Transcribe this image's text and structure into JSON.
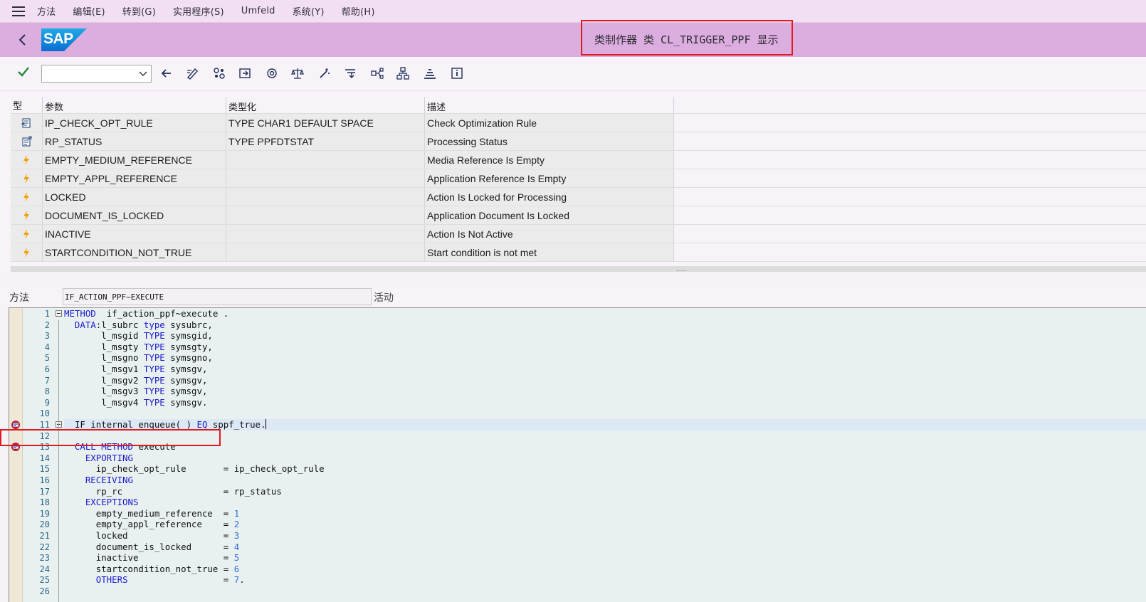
{
  "menu": {
    "items": [
      "方法",
      "编辑(E)",
      "转到(G)",
      "实用程序(S)",
      "Umfeld",
      "系统(Y)",
      "帮助(H)"
    ]
  },
  "header": {
    "logo_text": "SAP",
    "title": "类制作器 类 CL_TRIGGER_PPF 显示"
  },
  "toolbar": {
    "combo_value": "",
    "icons": [
      "check-icon",
      "back-arrow-icon",
      "display-change-icon",
      "activate-icon",
      "where-used-icon",
      "object-list-icon",
      "balance-icon",
      "pattern-icon",
      "pretty-print-icon",
      "navigate-icon",
      "hierarchy-icon",
      "stack-icon",
      "info-icon"
    ]
  },
  "params": {
    "headers": [
      "型",
      "参数",
      "类型化",
      "描述"
    ],
    "rows": [
      {
        "icon": "import-param-icon",
        "name": "IP_CHECK_OPT_RULE",
        "typing": "TYPE CHAR1  DEFAULT SPACE",
        "desc": "Check Optimization Rule"
      },
      {
        "icon": "return-param-icon",
        "name": "RP_STATUS",
        "typing": "TYPE PPFDTSTAT",
        "desc": "Processing Status"
      },
      {
        "icon": "exception-icon",
        "name": "EMPTY_MEDIUM_REFERENCE",
        "typing": "",
        "desc": "Media Reference Is Empty"
      },
      {
        "icon": "exception-icon",
        "name": "EMPTY_APPL_REFERENCE",
        "typing": "",
        "desc": "Application Reference Is Empty"
      },
      {
        "icon": "exception-icon",
        "name": "LOCKED",
        "typing": "",
        "desc": "Action Is Locked for Processing"
      },
      {
        "icon": "exception-icon",
        "name": "DOCUMENT_IS_LOCKED",
        "typing": "",
        "desc": "Application Document Is Locked"
      },
      {
        "icon": "exception-icon",
        "name": "INACTIVE",
        "typing": "",
        "desc": "Action Is Not Active"
      },
      {
        "icon": "exception-icon",
        "name": "STARTCONDITION_NOT_TRUE",
        "typing": "",
        "desc": "Start condition is not met"
      }
    ]
  },
  "method": {
    "label": "方法",
    "name": "IF_ACTION_PPF~EXECUTE",
    "status": "活动"
  },
  "code": {
    "lines": [
      {
        "n": "1",
        "parts": [
          [
            "kw",
            "METHOD"
          ],
          [
            "",
            "  if_action_ppf~execute ."
          ]
        ]
      },
      {
        "n": "2",
        "parts": [
          [
            "",
            "  "
          ],
          [
            "kw",
            "DATA"
          ],
          [
            "",
            ":l_subrc "
          ],
          [
            "kw",
            "type"
          ],
          [
            "",
            " sysubrc,"
          ]
        ]
      },
      {
        "n": "3",
        "parts": [
          [
            "",
            "       l_msgid "
          ],
          [
            "kw",
            "TYPE"
          ],
          [
            "",
            " symsgid,"
          ]
        ]
      },
      {
        "n": "4",
        "parts": [
          [
            "",
            "       l_msgty "
          ],
          [
            "kw",
            "TYPE"
          ],
          [
            "",
            " symsgty,"
          ]
        ]
      },
      {
        "n": "5",
        "parts": [
          [
            "",
            "       l_msgno "
          ],
          [
            "kw",
            "TYPE"
          ],
          [
            "",
            " symsgno,"
          ]
        ]
      },
      {
        "n": "6",
        "parts": [
          [
            "",
            "       l_msgv1 "
          ],
          [
            "kw",
            "TYPE"
          ],
          [
            "",
            " symsgv,"
          ]
        ]
      },
      {
        "n": "7",
        "parts": [
          [
            "",
            "       l_msgv2 "
          ],
          [
            "kw",
            "TYPE"
          ],
          [
            "",
            " symsgv,"
          ]
        ]
      },
      {
        "n": "8",
        "parts": [
          [
            "",
            "       l_msgv3 "
          ],
          [
            "kw",
            "TYPE"
          ],
          [
            "",
            " symsgv,"
          ]
        ]
      },
      {
        "n": "9",
        "parts": [
          [
            "",
            "       l_msgv4 "
          ],
          [
            "kw",
            "TYPE"
          ],
          [
            "",
            " symsgv."
          ]
        ]
      },
      {
        "n": "10",
        "parts": []
      },
      {
        "n": "11",
        "parts": [
          [
            "",
            "  IF internal_enqueue( ) "
          ],
          [
            "kw",
            "EQ"
          ],
          [
            "",
            " sppf_true."
          ]
        ]
      },
      {
        "n": "12",
        "parts": []
      },
      {
        "n": "13",
        "parts": [
          [
            "",
            "  "
          ],
          [
            "kw",
            "CALL"
          ],
          [
            "",
            " "
          ],
          [
            "kw",
            "METHOD"
          ],
          [
            "",
            " execute"
          ]
        ]
      },
      {
        "n": "14",
        "parts": [
          [
            "",
            "    "
          ],
          [
            "kw",
            "EXPORTING"
          ]
        ]
      },
      {
        "n": "15",
        "parts": [
          [
            "",
            "      ip_check_opt_rule       = ip_check_opt_rule"
          ]
        ]
      },
      {
        "n": "16",
        "parts": [
          [
            "",
            "    "
          ],
          [
            "kw",
            "RECEIVING"
          ]
        ]
      },
      {
        "n": "17",
        "parts": [
          [
            "",
            "      rp_rc                   = rp_status"
          ]
        ]
      },
      {
        "n": "18",
        "parts": [
          [
            "",
            "    "
          ],
          [
            "kw",
            "EXCEPTIONS"
          ]
        ]
      },
      {
        "n": "19",
        "parts": [
          [
            "",
            "      empty_medium_reference  = "
          ],
          [
            "num",
            "1"
          ]
        ]
      },
      {
        "n": "20",
        "parts": [
          [
            "",
            "      empty_appl_reference    = "
          ],
          [
            "num",
            "2"
          ]
        ]
      },
      {
        "n": "21",
        "parts": [
          [
            "",
            "      locked                  = "
          ],
          [
            "num",
            "3"
          ]
        ]
      },
      {
        "n": "22",
        "parts": [
          [
            "",
            "      document_is_locked      = "
          ],
          [
            "num",
            "4"
          ]
        ]
      },
      {
        "n": "23",
        "parts": [
          [
            "",
            "      inactive                = "
          ],
          [
            "num",
            "5"
          ]
        ]
      },
      {
        "n": "24",
        "parts": [
          [
            "",
            "      startcondition_not_true = "
          ],
          [
            "num",
            "6"
          ]
        ]
      },
      {
        "n": "25",
        "parts": [
          [
            "",
            "      "
          ],
          [
            "kw",
            "OTHERS"
          ],
          [
            "",
            "                  = "
          ],
          [
            "num",
            "7"
          ],
          [
            "",
            "."
          ]
        ]
      },
      {
        "n": "26",
        "parts": []
      }
    ]
  },
  "colors": {
    "menubar": "#f3dff3",
    "titlebar": "#dcaee0",
    "highlight_box": "#e01a22",
    "keyword": "#1a1acd"
  }
}
